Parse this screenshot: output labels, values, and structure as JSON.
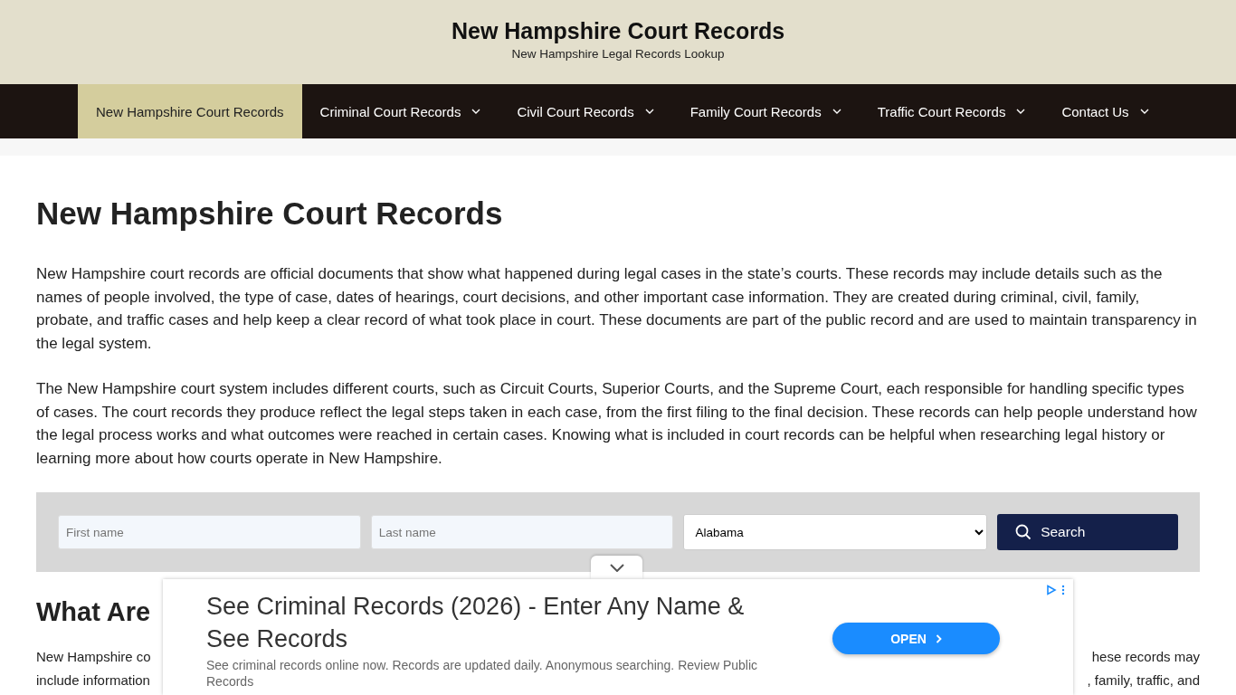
{
  "site": {
    "title": "New Hampshire Court Records",
    "tagline": "New Hampshire Legal Records Lookup"
  },
  "nav": [
    {
      "label": "New Hampshire Court Records",
      "selected": true,
      "dropdown": false
    },
    {
      "label": "Criminal Court Records",
      "selected": false,
      "dropdown": true
    },
    {
      "label": "Civil Court Records",
      "selected": false,
      "dropdown": true
    },
    {
      "label": "Family Court Records",
      "selected": false,
      "dropdown": true
    },
    {
      "label": "Traffic Court Records",
      "selected": false,
      "dropdown": true
    },
    {
      "label": "Contact Us",
      "selected": false,
      "dropdown": true
    }
  ],
  "heading": "New Hampshire Court Records",
  "paragraphs": [
    "New Hampshire court records are official documents that show what happened during legal cases in the state’s courts. These records may include details such as the names of people involved, the type of case, dates of hearings, court decisions, and other important case information. They are created during criminal, civil, family, probate, and traffic cases and help keep a clear record of what took place in court. These documents are part of the public record and are used to maintain transparency in the legal system.",
    "The New Hampshire court system includes different courts, such as Circuit Courts, Superior Courts, and the Supreme Court, each responsible for handling specific types of cases. The court records they produce reflect the legal steps taken in each case, from the first filing to the final decision. These records can help people understand how the legal process works and what outcomes were reached in certain cases. Knowing what is included in court records can be helpful when researching legal history or learning more about how courts operate in New Hampshire."
  ],
  "search": {
    "first_name": {
      "placeholder": "First name"
    },
    "last_name": {
      "placeholder": "Last name"
    },
    "state": {
      "value": "Alabama"
    },
    "button": "Search"
  },
  "section2": {
    "heading": "What Are",
    "lines": [
      {
        "left": "New Hampshire co",
        "right": "hese records may"
      },
      {
        "left": "include information",
        "right": ", family, traffic, and"
      }
    ]
  },
  "ad": {
    "title": "See Criminal Records (2026) - Enter Any Name & See Records",
    "description": "See criminal records online now. Records are updated daily. Anonymous searching. Review Public Records",
    "button": "OPEN"
  }
}
